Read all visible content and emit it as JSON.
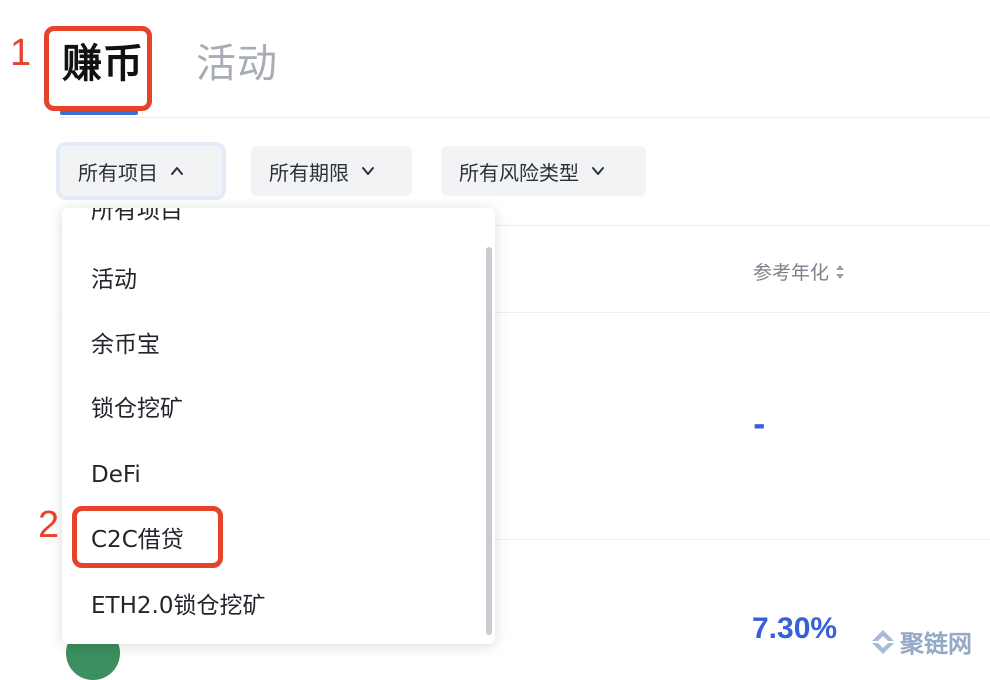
{
  "tabs": [
    {
      "label": "赚币",
      "active": true
    },
    {
      "label": "活动",
      "active": false
    }
  ],
  "annotations": [
    "1",
    "2"
  ],
  "filters": [
    {
      "label": "所有项目",
      "open": true
    },
    {
      "label": "所有期限",
      "open": false
    },
    {
      "label": "所有风险类型",
      "open": false
    }
  ],
  "table": {
    "rate_header": "参考年化",
    "rows": [
      {
        "rate": "-"
      },
      {
        "rate": "7.30%"
      }
    ]
  },
  "dropdown": {
    "items": [
      "所有项目",
      "活动",
      "余币宝",
      "锁仓挖矿",
      "DeFi",
      "C2C借贷",
      "ETH2.0锁仓挖矿"
    ],
    "highlighted": "C2C借贷"
  },
  "watermark": "聚链网",
  "colors": {
    "accent": "#3b6fd8",
    "annotation": "#e5432b",
    "rate": "#3561d6"
  }
}
